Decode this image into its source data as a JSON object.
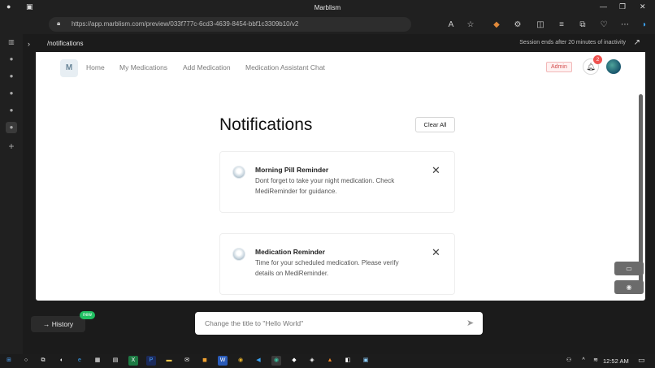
{
  "window": {
    "title": "Marblism"
  },
  "browser": {
    "url_host": "https://app.marblism.com",
    "url_path": "/preview/033f777c-6cd3-4639-8454-bbf1c3309b10/v2"
  },
  "app_bar": {
    "path": "/notifications",
    "session_text": "Session ends after 20 minutes of inactivity"
  },
  "nav": {
    "logo_letter": "M",
    "links": [
      "Home",
      "My Medications",
      "Add Medication",
      "Medication Assistant Chat"
    ],
    "admin_label": "Admin",
    "notification_count": "2"
  },
  "main": {
    "heading": "Notifications",
    "clear_all_label": "Clear All",
    "notifications": [
      {
        "title": "Morning Pill Reminder",
        "body": "Dont forget to take your night medication. Check MediReminder for guidance."
      },
      {
        "title": "Medication Reminder",
        "body": "Time for your scheduled medication. Please verify details on MediReminder."
      }
    ]
  },
  "chat": {
    "history_label": "History",
    "new_badge": "new",
    "placeholder": "Change the title to \"Hello World\""
  },
  "taskbar": {
    "time": "12:52 AM"
  }
}
